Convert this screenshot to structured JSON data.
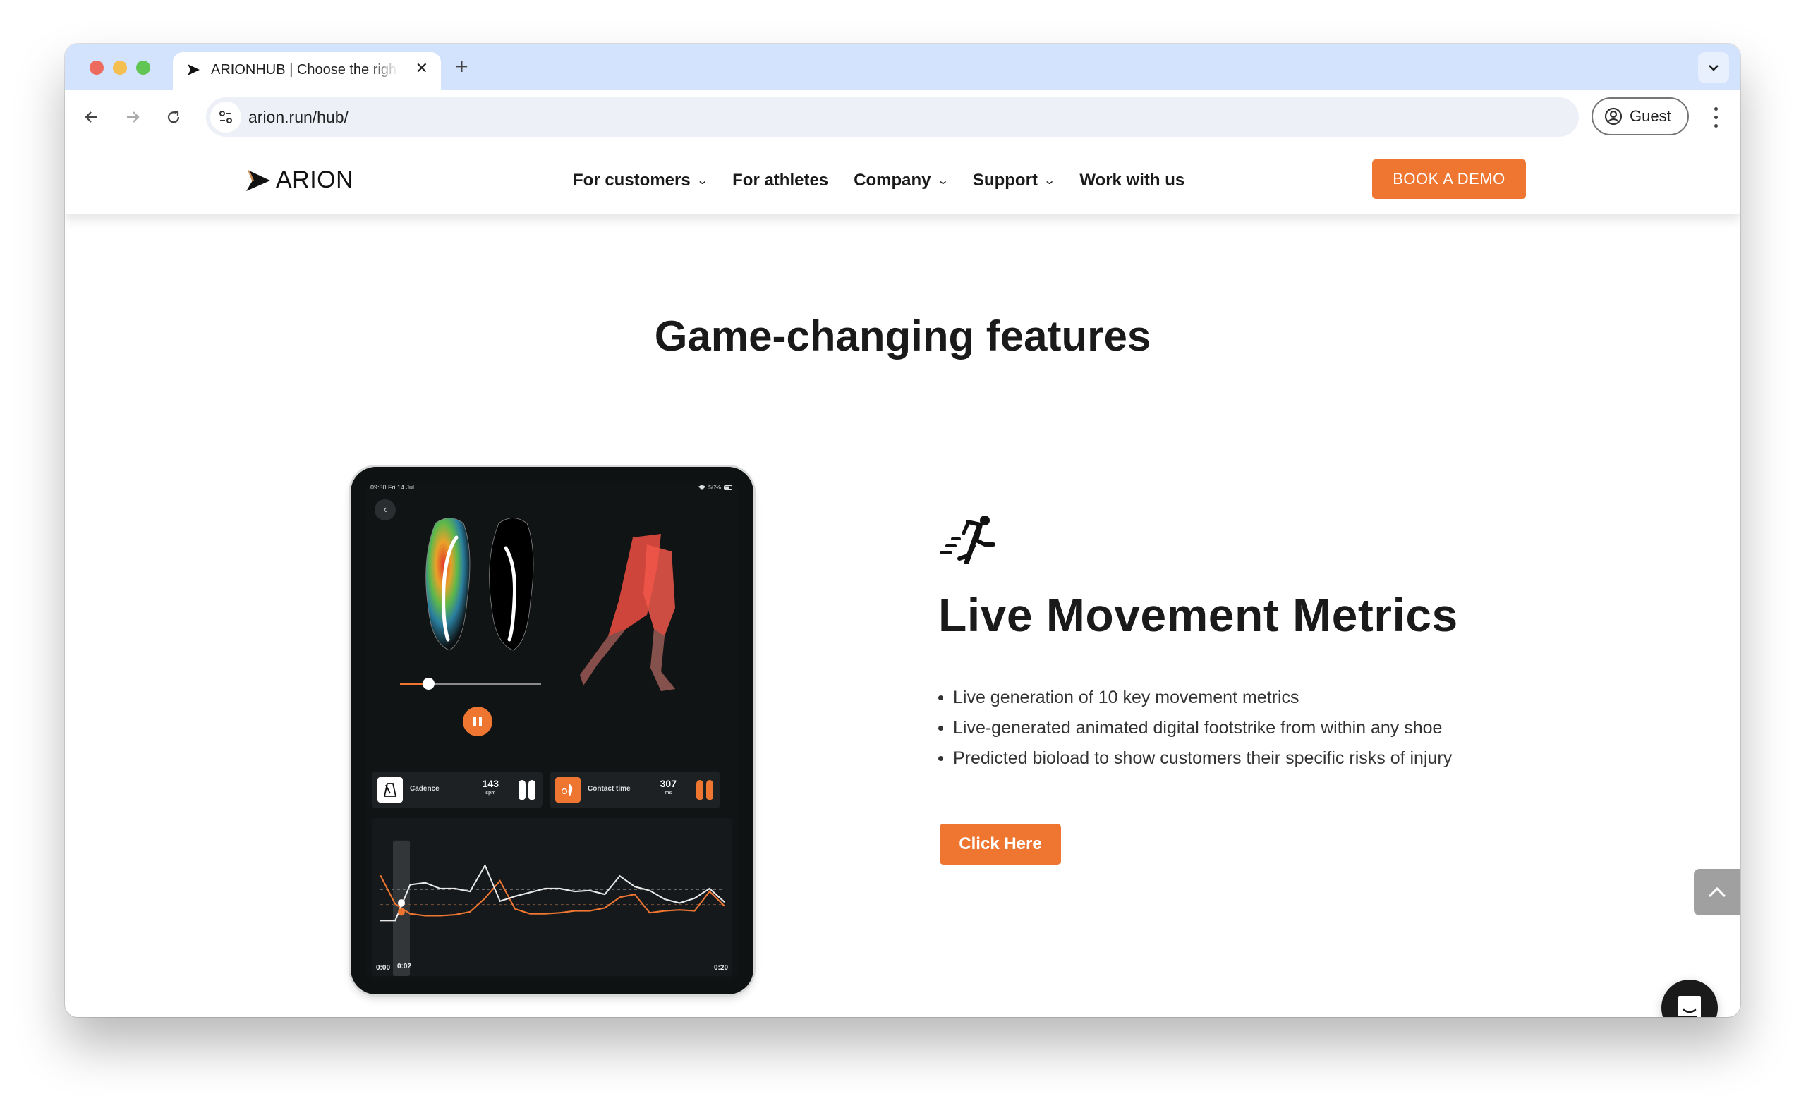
{
  "browser": {
    "tab_title": "ARIONHUB | Choose the right",
    "url": "arion.run/hub/",
    "profile_label": "Guest",
    "icons": [
      "close-icon",
      "plus-icon",
      "chevron-down-icon",
      "back-arrow-icon",
      "forward-arrow-icon",
      "reload-icon",
      "site-settings-icon",
      "profile-icon",
      "kebab-menu-icon"
    ]
  },
  "site": {
    "logo_text": "ARION",
    "nav": [
      {
        "label": "For customers",
        "has_dropdown": true
      },
      {
        "label": "For athletes",
        "has_dropdown": false
      },
      {
        "label": "Company",
        "has_dropdown": true
      },
      {
        "label": "Support",
        "has_dropdown": true
      },
      {
        "label": "Work with us",
        "has_dropdown": false
      }
    ],
    "cta_label": "BOOK A DEMO",
    "accent_color": "#ee7631"
  },
  "section": {
    "title": "Game-changing features"
  },
  "tablet": {
    "status_time": "09:30  Fri 14 Jul",
    "battery": "56%",
    "playback_progress": 0.2,
    "metrics": [
      {
        "label": "Cadence",
        "value": "143",
        "unit": "spm",
        "icon": "metronome-icon"
      },
      {
        "label": "Contact time",
        "value": "307",
        "unit": "ms",
        "icon": "foot-timer-icon"
      }
    ],
    "timeline": {
      "start": "0:00",
      "current": "0:02",
      "end": "0:20"
    },
    "series_white": [
      0.25,
      0.25,
      0.62,
      0.64,
      0.58,
      0.58,
      0.55,
      0.82,
      0.45,
      0.5,
      0.54,
      0.58,
      0.58,
      0.55,
      0.56,
      0.52,
      0.71,
      0.6,
      0.56,
      0.47,
      0.43,
      0.48,
      0.58,
      0.44
    ],
    "series_orange": [
      0.72,
      0.42,
      0.32,
      0.3,
      0.3,
      0.31,
      0.34,
      0.48,
      0.66,
      0.37,
      0.32,
      0.32,
      0.33,
      0.35,
      0.35,
      0.38,
      0.49,
      0.52,
      0.33,
      0.35,
      0.36,
      0.35,
      0.55,
      0.4
    ]
  },
  "feature": {
    "icon": "running-person-icon",
    "title": "Live Movement Metrics",
    "bullets": [
      "Live generation of 10 key movement metrics",
      "Live-generated animated digital footstrike from within any shoe",
      "Predicted bioload to show customers their specific risks of injury"
    ],
    "button_label": "Click Here"
  },
  "floating": {
    "scroll_top_icon": "chevron-up-icon",
    "chat_icon": "chat-bubble-icon"
  }
}
